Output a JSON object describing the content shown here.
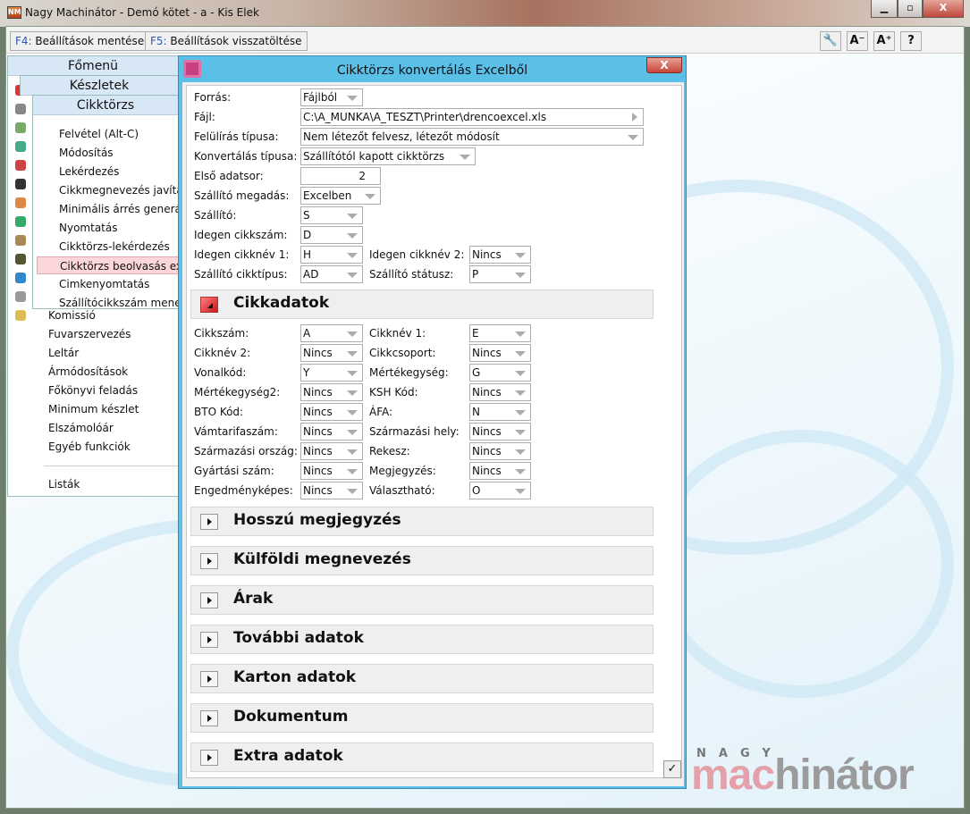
{
  "window": {
    "title": "Nagy Machinátor - Demó kötet - a - Kis Elek",
    "minimize": "▁",
    "maximize": "▫",
    "close": "X"
  },
  "toolbar": {
    "save": {
      "key": "F4:",
      "label": " Beállítások mentése"
    },
    "restore": {
      "key": "F5:",
      "label": " Beállítások visszatöltése"
    },
    "icons": [
      {
        "name": "wrench-icon",
        "text": "🔧"
      },
      {
        "name": "font-decrease-icon",
        "text": "A⁻"
      },
      {
        "name": "font-increase-icon",
        "text": "A⁺"
      },
      {
        "name": "help-icon",
        "text": "?"
      }
    ]
  },
  "menu": {
    "main_title": "Főmenü",
    "stock_title": "Készletek",
    "item_title": "Cikktörzs",
    "sub_items": [
      "Felvétel (Alt-C)",
      "Módosítás",
      "Lekérdezés",
      "Cikkmegnevezés javítás",
      "Minimális árrés generálás",
      "Nyomtatás",
      "Cikktörzs-lekérdezés",
      "Cikktörzs beolvasás excelből",
      "Cimkenyomtatás",
      "Szállítócikkszám menedzser"
    ],
    "selected_index": 7,
    "stock_items": [
      "Komissió",
      "Fuvarszervezés",
      "Leltár",
      "Ármódosítások",
      "Főkönyvi feladás",
      "Minimum  készlet",
      "Elszámolóár",
      "Egyéb funkciók"
    ],
    "lists": "Listák"
  },
  "dialog": {
    "title": "Cikktörzs konvertálás Excelből",
    "close": "X",
    "top_fields": [
      {
        "label": "Forrás:",
        "value": "Fájlból",
        "type": "combo"
      },
      {
        "label": "Fájl:",
        "value": "C:\\A_MUNKA\\A_TESZT\\Printer\\drencoexcel.xls",
        "type": "file"
      },
      {
        "label": "Felülírás típusa:",
        "value": "Nem létezőt felvesz, létezőt módosít",
        "type": "combo"
      },
      {
        "label": "Konvertálás típusa:",
        "value": "Szállítótól kapott cikktörzs",
        "type": "combo"
      },
      {
        "label": "Első adatsor:",
        "value": "2",
        "type": "number"
      },
      {
        "label": "Szállító megadás:",
        "value": "Excelben",
        "type": "combo"
      },
      {
        "label": "Szállító:",
        "value": "S",
        "type": "combo"
      },
      {
        "label": "Idegen cikkszám:",
        "value": "D",
        "type": "combo"
      }
    ],
    "pair_fields": [
      [
        {
          "label": "Idegen cikknév 1:",
          "value": "H"
        },
        {
          "label": "Idegen cikknév 2:",
          "value": "Nincs"
        }
      ],
      [
        {
          "label": "Szállító cikktípus:",
          "value": "AD"
        },
        {
          "label": "Szállító státusz:",
          "value": "P"
        }
      ]
    ],
    "item_section": {
      "title": "Cikkadatok",
      "fields": [
        [
          {
            "label": "Cikkszám:",
            "value": "A"
          },
          {
            "label": "Cikknév 1:",
            "value": "E"
          }
        ],
        [
          {
            "label": "Cikknév 2:",
            "value": "Nincs"
          },
          {
            "label": "Cikkcsoport:",
            "value": "Nincs"
          }
        ],
        [
          {
            "label": "Vonalkód:",
            "value": "Y"
          },
          {
            "label": "Mértékegység:",
            "value": "G"
          }
        ],
        [
          {
            "label": "Mértékegység2:",
            "value": "Nincs"
          },
          {
            "label": "KSH Kód:",
            "value": "Nincs"
          }
        ],
        [
          {
            "label": "BTO Kód:",
            "value": "Nincs"
          },
          {
            "label": "ÁFA:",
            "value": "N"
          }
        ],
        [
          {
            "label": "Vámtarifaszám:",
            "value": "Nincs"
          },
          {
            "label": "Származási hely:",
            "value": "Nincs"
          }
        ],
        [
          {
            "label": "Származási ország:",
            "value": "Nincs"
          },
          {
            "label": "Rekesz:",
            "value": "Nincs"
          }
        ],
        [
          {
            "label": "Gyártási szám:",
            "value": "Nincs"
          },
          {
            "label": "Megjegyzés:",
            "value": "Nincs"
          }
        ],
        [
          {
            "label": "Engedményképes:",
            "value": "Nincs"
          },
          {
            "label": "Választható:",
            "value": "O"
          }
        ]
      ]
    },
    "collapsed_sections": [
      "Hosszú megjegyzés",
      "Külföldi megnevezés",
      "Árak",
      "További adatok",
      "Karton adatok",
      "Dokumentum",
      "Extra adatok"
    ],
    "ok": "✓"
  },
  "logo": {
    "small": "NAGY",
    "part1": "mac",
    "part2": "hinátor"
  },
  "colors": {
    "dialog_title": "#5bc0e8",
    "selected_item": "#fcd6d8",
    "section_open": "#d42020",
    "logo_pink": "#e4a0a8"
  }
}
